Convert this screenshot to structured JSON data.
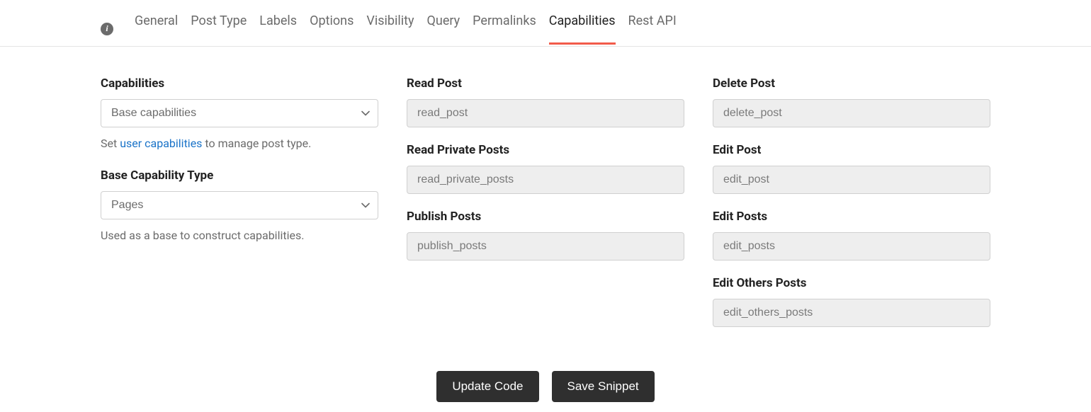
{
  "tabs": {
    "items": [
      {
        "label": "General"
      },
      {
        "label": "Post Type"
      },
      {
        "label": "Labels"
      },
      {
        "label": "Options"
      },
      {
        "label": "Visibility"
      },
      {
        "label": "Query"
      },
      {
        "label": "Permalinks"
      },
      {
        "label": "Capabilities"
      },
      {
        "label": "Rest API"
      }
    ],
    "active_index": 7
  },
  "col1": {
    "capabilities_label": "Capabilities",
    "capabilities_value": "Base capabilities",
    "capabilities_help_prefix": "Set ",
    "capabilities_help_link": "user capabilities",
    "capabilities_help_suffix": " to manage post type.",
    "base_type_label": "Base Capability Type",
    "base_type_value": "Pages",
    "base_type_help": "Used as a base to construct capabilities."
  },
  "col2": {
    "read_post_label": "Read Post",
    "read_post_value": "read_post",
    "read_private_label": "Read Private Posts",
    "read_private_value": "read_private_posts",
    "publish_label": "Publish Posts",
    "publish_value": "publish_posts"
  },
  "col3": {
    "delete_post_label": "Delete Post",
    "delete_post_value": "delete_post",
    "edit_post_label": "Edit Post",
    "edit_post_value": "edit_post",
    "edit_posts_label": "Edit Posts",
    "edit_posts_value": "edit_posts",
    "edit_others_label": "Edit Others Posts",
    "edit_others_value": "edit_others_posts"
  },
  "footer": {
    "update_code": "Update Code",
    "save_snippet": "Save Snippet"
  }
}
